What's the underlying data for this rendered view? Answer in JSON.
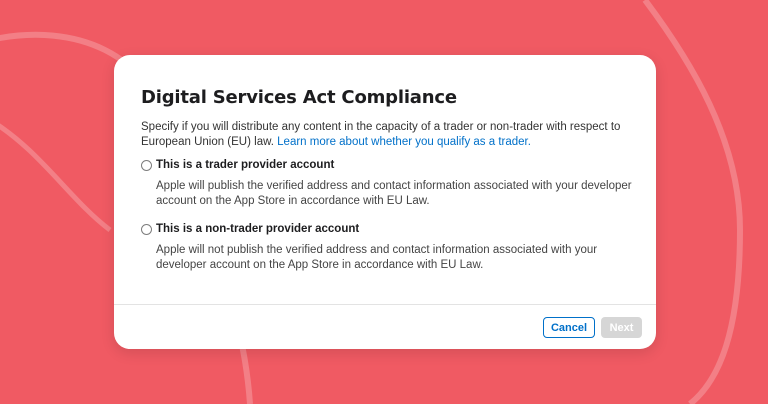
{
  "dialog": {
    "title": "Digital Services Act Compliance",
    "intro_text": "Specify if you will distribute any content in the capacity of a trader or non-trader with respect to European Union (EU) law. ",
    "intro_link": "Learn more about whether you qualify as a trader."
  },
  "options": [
    {
      "label": "This is a trader provider account",
      "description": "Apple will publish the verified address and contact information associated with your developer account on the App Store in accordance with EU Law.",
      "selected": false
    },
    {
      "label": "This is a non-trader provider account",
      "description": "Apple will not publish the verified address and contact information associated with your developer account on the App Store in accordance with EU Law.",
      "selected": false
    }
  ],
  "buttons": {
    "cancel": "Cancel",
    "next": "Next"
  },
  "colors": {
    "background": "#f05a63",
    "accent": "#0070c9",
    "disabled_button": "#d6d6d6"
  }
}
